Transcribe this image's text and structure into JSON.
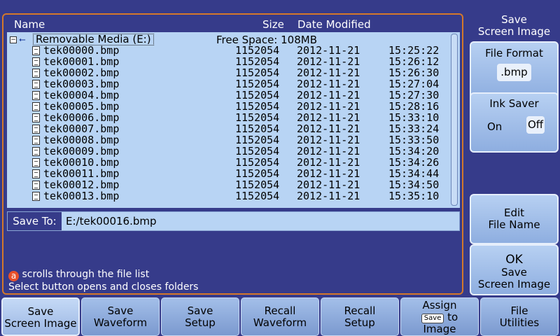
{
  "list_header": {
    "name": "Name",
    "size": "Size",
    "date": "Date Modified"
  },
  "tree": {
    "expander": "−",
    "root_label": "Removable Media (E:)",
    "free_space": "Free Space:  108MB"
  },
  "files": [
    {
      "name": "tek00000.bmp",
      "size": "1152054",
      "date": "2012-11-21",
      "time": "15:25:22"
    },
    {
      "name": "tek00001.bmp",
      "size": "1152054",
      "date": "2012-11-21",
      "time": "15:26:12"
    },
    {
      "name": "tek00002.bmp",
      "size": "1152054",
      "date": "2012-11-21",
      "time": "15:26:30"
    },
    {
      "name": "tek00003.bmp",
      "size": "1152054",
      "date": "2012-11-21",
      "time": "15:27:04"
    },
    {
      "name": "tek00004.bmp",
      "size": "1152054",
      "date": "2012-11-21",
      "time": "15:27:30"
    },
    {
      "name": "tek00005.bmp",
      "size": "1152054",
      "date": "2012-11-21",
      "time": "15:28:16"
    },
    {
      "name": "tek00006.bmp",
      "size": "1152054",
      "date": "2012-11-21",
      "time": "15:33:10"
    },
    {
      "name": "tek00007.bmp",
      "size": "1152054",
      "date": "2012-11-21",
      "time": "15:33:24"
    },
    {
      "name": "tek00008.bmp",
      "size": "1152054",
      "date": "2012-11-21",
      "time": "15:33:50"
    },
    {
      "name": "tek00009.bmp",
      "size": "1152054",
      "date": "2012-11-21",
      "time": "15:34:20"
    },
    {
      "name": "tek00010.bmp",
      "size": "1152054",
      "date": "2012-11-21",
      "time": "15:34:26"
    },
    {
      "name": "tek00011.bmp",
      "size": "1152054",
      "date": "2012-11-21",
      "time": "15:34:44"
    },
    {
      "name": "tek00012.bmp",
      "size": "1152054",
      "date": "2012-11-21",
      "time": "15:34:50"
    },
    {
      "name": "tek00013.bmp",
      "size": "1152054",
      "date": "2012-11-21",
      "time": "15:35:10"
    }
  ],
  "save_to": {
    "label": "Save To:",
    "path": "E:/tek00016.bmp"
  },
  "help": {
    "knob": "a",
    "line1": "scrolls through the file list",
    "line2": "Select button opens and closes folders"
  },
  "side_menu": {
    "title_line1": "Save",
    "title_line2": "Screen Image",
    "file_format_label": "File Format",
    "file_format_value": ".bmp",
    "ink_saver_label": "Ink Saver",
    "ink_on": "On",
    "ink_off": "Off",
    "edit_line1": "Edit",
    "edit_line2": "File Name",
    "ok_line1": "OK",
    "ok_line2": "Save",
    "ok_line3": "Screen Image"
  },
  "bottom_menu": {
    "save_screen_line1": "Save",
    "save_screen_line2": "Screen Image",
    "save_waveform_line1": "Save",
    "save_waveform_line2": "Waveform",
    "save_setup_line1": "Save",
    "save_setup_line2": "Setup",
    "recall_waveform_line1": "Recall",
    "recall_waveform_line2": "Waveform",
    "recall_setup_line1": "Recall",
    "recall_setup_line2": "Setup",
    "assign_line1": "Assign",
    "assign_chip": "Save",
    "assign_to": "to",
    "assign_line3": "Image",
    "file_util_line1": "File",
    "file_util_line2": "Utilities"
  }
}
